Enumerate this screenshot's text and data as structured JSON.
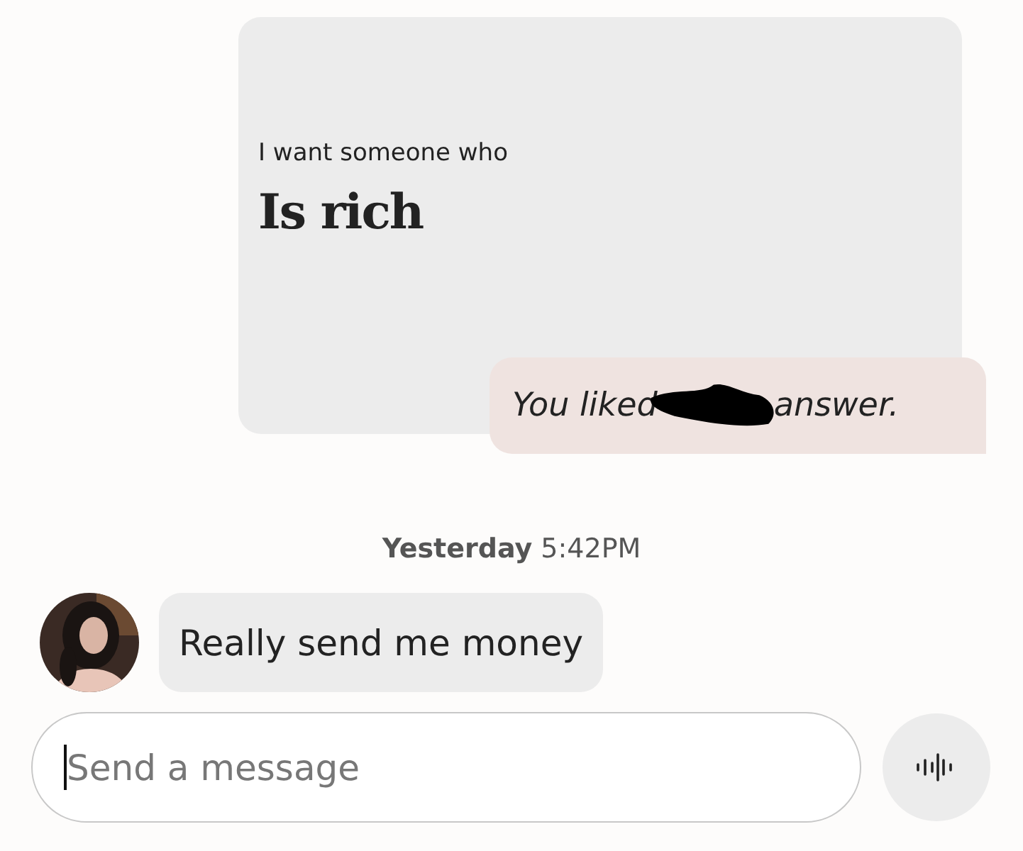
{
  "prompt_card": {
    "prompt": "I want someone who",
    "answer": "Is rich"
  },
  "like_note": {
    "before": "You liked",
    "after": "answer.",
    "redacted": true
  },
  "timestamp": {
    "day": "Yesterday",
    "time": "5:42PM"
  },
  "messages": [
    {
      "kind": "received",
      "text": "Really send me money"
    }
  ],
  "composer": {
    "placeholder": "Send a message",
    "focused": true
  }
}
